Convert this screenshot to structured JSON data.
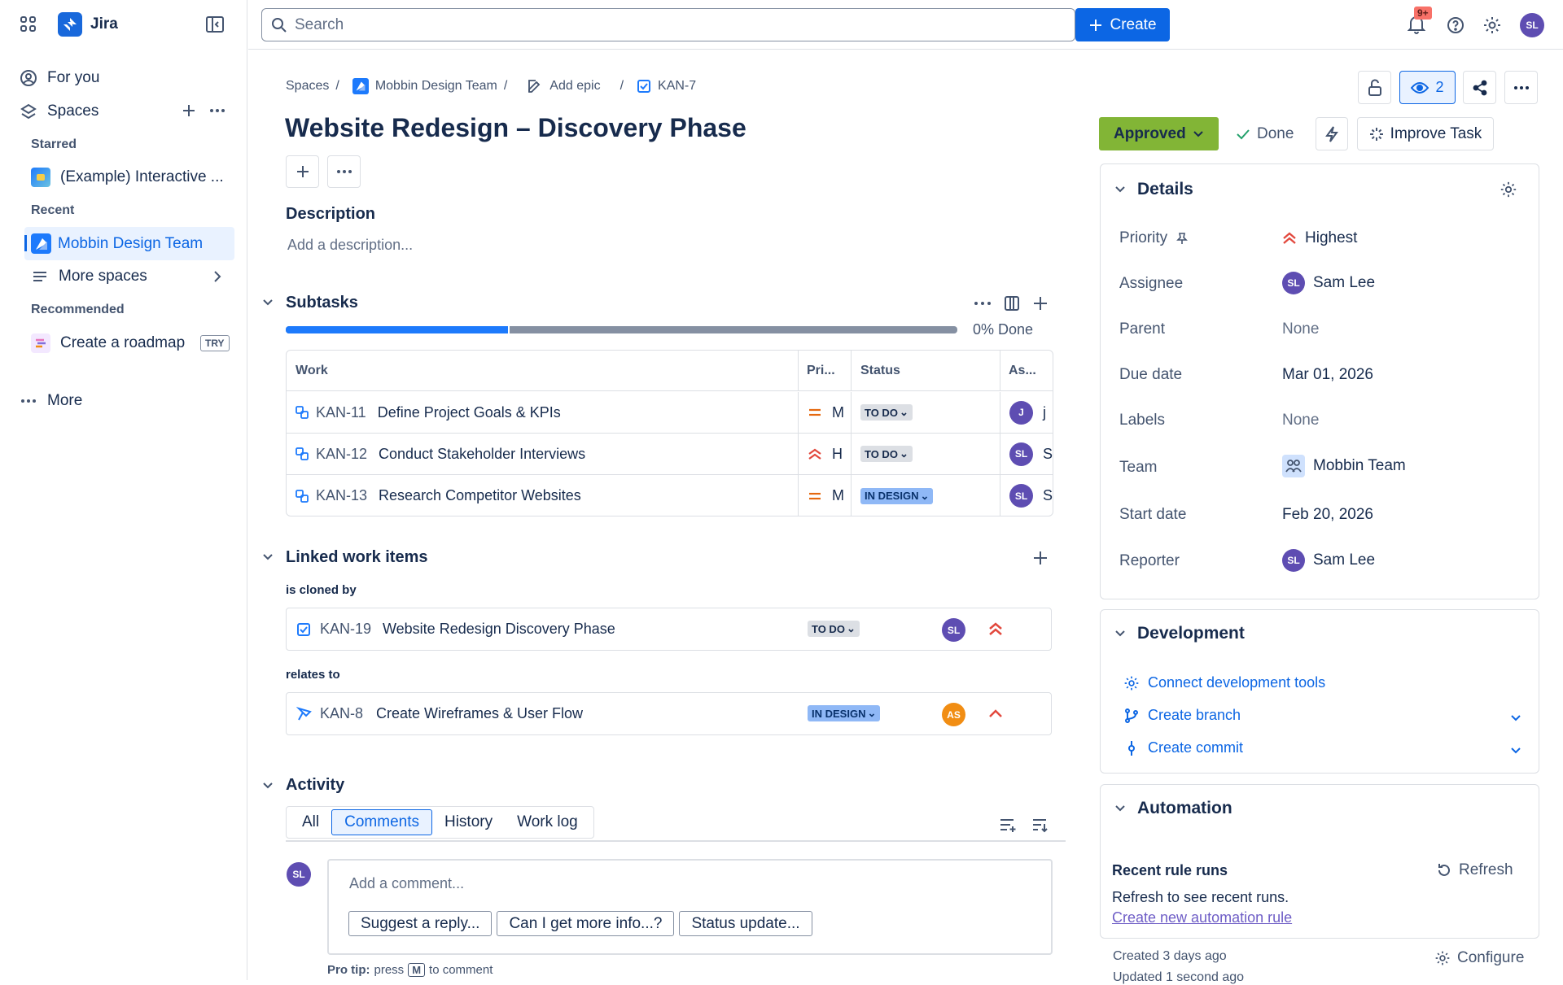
{
  "sidebar": {
    "app_name": "Jira",
    "for_you": "For you",
    "spaces": "Spaces",
    "starred_label": "Starred",
    "starred_item": "(Example) Interactive ...",
    "recent_label": "Recent",
    "recent_item": "Mobbin Design Team",
    "more_spaces": "More spaces",
    "recommended_label": "Recommended",
    "roadmap": "Create a roadmap",
    "try_badge": "TRY",
    "more": "More"
  },
  "topbar": {
    "search_placeholder": "Search",
    "create_label": "Create",
    "notification_count": "9+",
    "user_initials": "SL"
  },
  "breadcrumb": {
    "spaces": "Spaces",
    "team": "Mobbin Design Team",
    "add_epic": "Add epic",
    "issue_key": "KAN-7"
  },
  "issue": {
    "title": "Website Redesign – Discovery Phase",
    "watchers": "2",
    "description_heading": "Description",
    "description_placeholder": "Add a description..."
  },
  "subtasks": {
    "heading": "Subtasks",
    "progress_pct": 0,
    "progress_text": "0% Done",
    "columns": [
      "Work",
      "Pri...",
      "Status",
      "As..."
    ],
    "rows": [
      {
        "key": "KAN-11",
        "summary": "Define Project Goals & KPIs",
        "priority": "M",
        "priority_icon": "medium-priority-icon",
        "status": "TO DO",
        "assignee_initials": "J",
        "assignee_name": "j"
      },
      {
        "key": "KAN-12",
        "summary": "Conduct Stakeholder Interviews",
        "priority": "H",
        "priority_icon": "high-priority-icon",
        "status": "TO DO",
        "assignee_initials": "SL",
        "assignee_name": "S"
      },
      {
        "key": "KAN-13",
        "summary": "Research Competitor Websites",
        "priority": "M",
        "priority_icon": "medium-priority-icon",
        "status": "IN DESIGN",
        "assignee_initials": "SL",
        "assignee_name": "S"
      }
    ]
  },
  "linked": {
    "heading": "Linked work items",
    "groups": [
      {
        "relation": "is cloned by",
        "key": "KAN-19",
        "summary": "Website Redesign Discovery Phase",
        "status": "TO DO",
        "assignee": "SL",
        "priority_icon": "highest-priority-icon"
      },
      {
        "relation": "relates to",
        "key": "KAN-8",
        "summary": "Create Wireframes & User Flow",
        "status": "IN DESIGN",
        "assignee": "AS",
        "priority_icon": "high-priority-icon"
      }
    ]
  },
  "activity": {
    "heading": "Activity",
    "tabs": [
      "All",
      "Comments",
      "History",
      "Work log"
    ],
    "active_tab": "Comments",
    "comment_placeholder": "Add a comment...",
    "suggestions": [
      "Suggest a reply...",
      "Can I get more info...?",
      "Status update..."
    ],
    "pro_tip_label": "Pro tip:",
    "pro_tip_press": "press",
    "pro_tip_key": "M",
    "pro_tip_rest": "to comment",
    "user_initials": "SL"
  },
  "status_bar": {
    "status": "Approved",
    "done": "Done",
    "improve": "Improve Task"
  },
  "details": {
    "heading": "Details",
    "fields": [
      {
        "label": "Priority",
        "value": "Highest"
      },
      {
        "label": "Assignee",
        "value": "Sam Lee",
        "initials": "SL"
      },
      {
        "label": "Parent",
        "value": "None"
      },
      {
        "label": "Due date",
        "value": "Mar 01, 2026"
      },
      {
        "label": "Labels",
        "value": "None"
      },
      {
        "label": "Team",
        "value": "Mobbin Team"
      },
      {
        "label": "Start date",
        "value": "Feb 20, 2026"
      },
      {
        "label": "Reporter",
        "value": "Sam Lee",
        "initials": "SL"
      }
    ]
  },
  "development": {
    "heading": "Development",
    "connect": "Connect development tools",
    "branch": "Create branch",
    "commit": "Create commit"
  },
  "automation": {
    "heading": "Automation",
    "recent_runs": "Recent rule runs",
    "refresh": "Refresh",
    "hint": "Refresh to see recent runs.",
    "create_rule": "Create new automation rule"
  },
  "footer": {
    "created": "Created 3 days ago",
    "updated": "Updated 1 second ago",
    "configure": "Configure"
  },
  "colors": {
    "accent": "#0c66e4",
    "approved": "#82b536",
    "avatar_purple": "#5e4db2",
    "avatar_orange": "#f18d13",
    "priority_red": "#e2483d",
    "priority_orange": "#e56910"
  }
}
